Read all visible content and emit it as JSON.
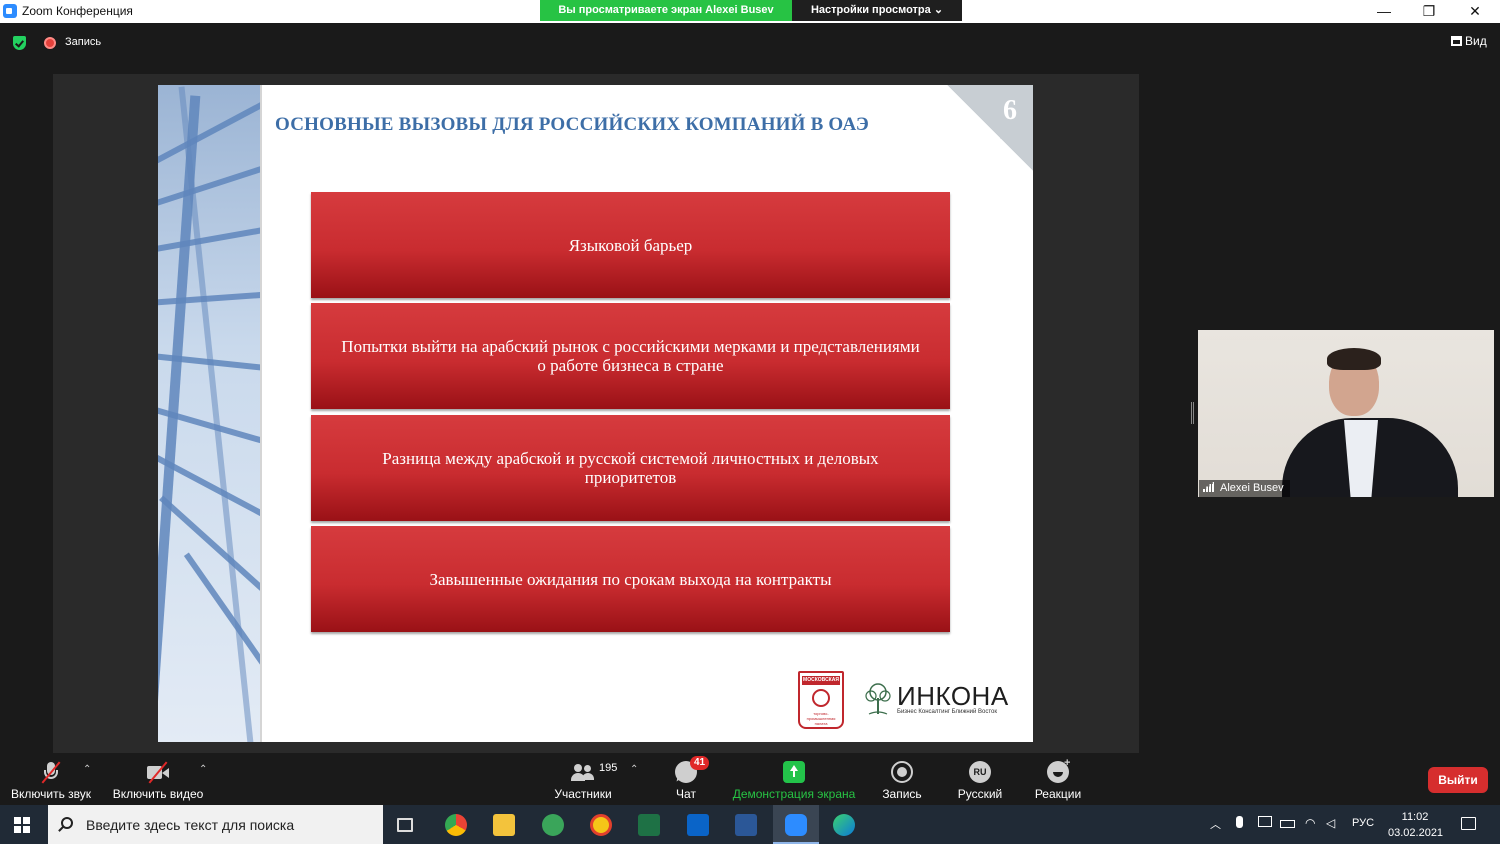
{
  "window": {
    "title": "Zoom Конференция",
    "share_banner": "Вы просматриваете экран Alexei Busev",
    "view_settings": "Настройки просмотра ⌄",
    "minimize": "—",
    "maximize": "❐",
    "close": "✕"
  },
  "topbar": {
    "recording_label": "Запись",
    "view_label": "Вид"
  },
  "slide": {
    "number": "6",
    "title": "ОСНОВНЫЕ ВЫЗОВЫ ДЛЯ РОССИЙСКИХ КОМПАНИЙ В ОАЭ",
    "items": [
      "Языковой барьер",
      "Попытки выйти на арабский рынок с российскими мерками и представлениями о работе бизнеса в стране",
      "Разница между арабской и русской системой личностных и деловых приоритетов",
      "Завышенные ожидания по срокам выхода на контракты"
    ],
    "logo_mtpp_band": "МОСКОВСКАЯ",
    "logo_mtpp_sub": "торгово-промышленная палата",
    "logo_inkona": "ИНКОНА",
    "logo_inkona_sub": "Бизнес Консалтинг Ближний Восток"
  },
  "video": {
    "participant_name": "Alexei Busev"
  },
  "controls": {
    "unmute_label": "Включить звук",
    "start_video_label": "Включить видео",
    "participants_count": "195",
    "participants_label": "Участники",
    "chat_label": "Чат",
    "chat_badge": "41",
    "share_label": "Демонстрация экрана",
    "record_label": "Запись",
    "language_code": "RU",
    "language_label": "Русский",
    "reactions_label": "Реакции",
    "leave_label": "Выйти",
    "caret": "⌃"
  },
  "taskbar": {
    "search_placeholder": "Введите здесь текст для поиска",
    "tray_lang": "РУС",
    "time": "11:02",
    "date": "03.02.2021",
    "tray_up": "︿"
  },
  "colors": {
    "zoom_green": "#27c344",
    "slide_title_blue": "#3d6ea7",
    "slide_box_red": "#c92c30",
    "leave_red": "#d62e2e"
  }
}
